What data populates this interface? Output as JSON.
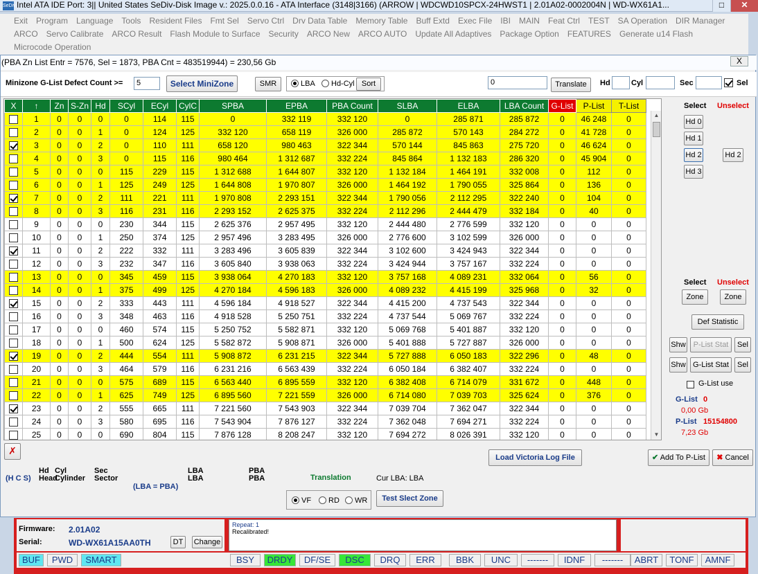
{
  "app": {
    "title": "Intel ATA IDE  Port: 3|| United States  SeDiv-Disk Image v.: 2025.0.0.16 - ATA Interface (3148|3166)  (ARROW | WDCWD10SPCX-24HWST1 | 2.01A02-0002004N | WD-WX61A1...",
    "icon_label": "SeDiv"
  },
  "menu": {
    "row1": [
      "Exit",
      "Program",
      "Language",
      "Tools",
      "Resident Files",
      "Fmt Sel",
      "Servo Ctrl",
      "Drv Data Table",
      "Memory Table",
      "Buff Extd",
      "Exec File",
      "IBI",
      "MAIN",
      "Feat Ctrl",
      "TEST",
      "SA Operation",
      "DIR Manager"
    ],
    "row2": [
      "ARCO",
      "Servo Calibrate",
      "ARCO Result",
      "Flash Module to Surface",
      "Security",
      "ARCO New",
      "ARCO AUTO",
      "Update All Adaptives",
      "Package Option",
      "FEATURES",
      "Generate u14 Flash"
    ],
    "row3": [
      "Microcode Operation"
    ]
  },
  "dialog": {
    "title": "(PBA Zn List Entr = 7576, Sel = 1873, PBA Cnt = 483519944) = 230,56 Gb",
    "close": "X"
  },
  "controls": {
    "minizone_label": "Minizone G-List Defect Count >=",
    "minizone_value": "5",
    "select_minizone": "Select MiniZone",
    "smr": "SMR",
    "lba": "LBA",
    "hdcyl": "Hd-Cyl",
    "sort": "Sort",
    "translate_value": "0",
    "translate": "Translate",
    "hd_label": "Hd",
    "cyl_label": "Cyl",
    "sec_label": "Sec",
    "sel_label": "Sel"
  },
  "table": {
    "headers": [
      "X",
      "↑",
      "Zn",
      "S-Zn",
      "Hd",
      "SCyl",
      "ECyl",
      "CylC",
      "SPBA",
      "EPBA",
      "PBA Count",
      "SLBA",
      "ELBA",
      "LBA Count",
      "G-List",
      "P-List",
      "T-List"
    ],
    "rows": [
      [
        "1",
        "0",
        "0",
        "0",
        "0",
        "114",
        "115",
        "0",
        "332 119",
        "332 120",
        "0",
        "285 871",
        "285 872",
        "0",
        "46 248",
        "0"
      ],
      [
        "2",
        "0",
        "0",
        "1",
        "0",
        "124",
        "125",
        "332 120",
        "658 119",
        "326 000",
        "285 872",
        "570 143",
        "284 272",
        "0",
        "41 728",
        "0"
      ],
      [
        "3",
        "0",
        "0",
        "2",
        "0",
        "110",
        "111",
        "658 120",
        "980 463",
        "322 344",
        "570 144",
        "845 863",
        "275 720",
        "0",
        "46 624",
        "0"
      ],
      [
        "4",
        "0",
        "0",
        "3",
        "0",
        "115",
        "116",
        "980 464",
        "1 312 687",
        "332 224",
        "845 864",
        "1 132 183",
        "286 320",
        "0",
        "45 904",
        "0"
      ],
      [
        "5",
        "0",
        "0",
        "0",
        "115",
        "229",
        "115",
        "1 312 688",
        "1 644 807",
        "332 120",
        "1 132 184",
        "1 464 191",
        "332 008",
        "0",
        "112",
        "0"
      ],
      [
        "6",
        "0",
        "0",
        "1",
        "125",
        "249",
        "125",
        "1 644 808",
        "1 970 807",
        "326 000",
        "1 464 192",
        "1 790 055",
        "325 864",
        "0",
        "136",
        "0"
      ],
      [
        "7",
        "0",
        "0",
        "2",
        "111",
        "221",
        "111",
        "1 970 808",
        "2 293 151",
        "322 344",
        "1 790 056",
        "2 112 295",
        "322 240",
        "0",
        "104",
        "0"
      ],
      [
        "8",
        "0",
        "0",
        "3",
        "116",
        "231",
        "116",
        "2 293 152",
        "2 625 375",
        "332 224",
        "2 112 296",
        "2 444 479",
        "332 184",
        "0",
        "40",
        "0"
      ],
      [
        "9",
        "0",
        "0",
        "0",
        "230",
        "344",
        "115",
        "2 625 376",
        "2 957 495",
        "332 120",
        "2 444 480",
        "2 776 599",
        "332 120",
        "0",
        "0",
        "0"
      ],
      [
        "10",
        "0",
        "0",
        "1",
        "250",
        "374",
        "125",
        "2 957 496",
        "3 283 495",
        "326 000",
        "2 776 600",
        "3 102 599",
        "326 000",
        "0",
        "0",
        "0"
      ],
      [
        "11",
        "0",
        "0",
        "2",
        "222",
        "332",
        "111",
        "3 283 496",
        "3 605 839",
        "322 344",
        "3 102 600",
        "3 424 943",
        "322 344",
        "0",
        "0",
        "0"
      ],
      [
        "12",
        "0",
        "0",
        "3",
        "232",
        "347",
        "116",
        "3 605 840",
        "3 938 063",
        "332 224",
        "3 424 944",
        "3 757 167",
        "332 224",
        "0",
        "0",
        "0"
      ],
      [
        "13",
        "0",
        "0",
        "0",
        "345",
        "459",
        "115",
        "3 938 064",
        "4 270 183",
        "332 120",
        "3 757 168",
        "4 089 231",
        "332 064",
        "0",
        "56",
        "0"
      ],
      [
        "14",
        "0",
        "0",
        "1",
        "375",
        "499",
        "125",
        "4 270 184",
        "4 596 183",
        "326 000",
        "4 089 232",
        "4 415 199",
        "325 968",
        "0",
        "32",
        "0"
      ],
      [
        "15",
        "0",
        "0",
        "2",
        "333",
        "443",
        "111",
        "4 596 184",
        "4 918 527",
        "322 344",
        "4 415 200",
        "4 737 543",
        "322 344",
        "0",
        "0",
        "0"
      ],
      [
        "16",
        "0",
        "0",
        "3",
        "348",
        "463",
        "116",
        "4 918 528",
        "5 250 751",
        "332 224",
        "4 737 544",
        "5 069 767",
        "332 224",
        "0",
        "0",
        "0"
      ],
      [
        "17",
        "0",
        "0",
        "0",
        "460",
        "574",
        "115",
        "5 250 752",
        "5 582 871",
        "332 120",
        "5 069 768",
        "5 401 887",
        "332 120",
        "0",
        "0",
        "0"
      ],
      [
        "18",
        "0",
        "0",
        "1",
        "500",
        "624",
        "125",
        "5 582 872",
        "5 908 871",
        "326 000",
        "5 401 888",
        "5 727 887",
        "326 000",
        "0",
        "0",
        "0"
      ],
      [
        "19",
        "0",
        "0",
        "2",
        "444",
        "554",
        "111",
        "5 908 872",
        "6 231 215",
        "322 344",
        "5 727 888",
        "6 050 183",
        "322 296",
        "0",
        "48",
        "0"
      ],
      [
        "20",
        "0",
        "0",
        "3",
        "464",
        "579",
        "116",
        "6 231 216",
        "6 563 439",
        "332 224",
        "6 050 184",
        "6 382 407",
        "332 224",
        "0",
        "0",
        "0"
      ],
      [
        "21",
        "0",
        "0",
        "0",
        "575",
        "689",
        "115",
        "6 563 440",
        "6 895 559",
        "332 120",
        "6 382 408",
        "6 714 079",
        "331 672",
        "0",
        "448",
        "0"
      ],
      [
        "22",
        "0",
        "0",
        "1",
        "625",
        "749",
        "125",
        "6 895 560",
        "7 221 559",
        "326 000",
        "6 714 080",
        "7 039 703",
        "325 624",
        "0",
        "376",
        "0"
      ],
      [
        "23",
        "0",
        "0",
        "2",
        "555",
        "665",
        "111",
        "7 221 560",
        "7 543 903",
        "322 344",
        "7 039 704",
        "7 362 047",
        "322 344",
        "0",
        "0",
        "0"
      ],
      [
        "24",
        "0",
        "0",
        "3",
        "580",
        "695",
        "116",
        "7 543 904",
        "7 876 127",
        "332 224",
        "7 362 048",
        "7 694 271",
        "332 224",
        "0",
        "0",
        "0"
      ],
      [
        "25",
        "0",
        "0",
        "0",
        "690",
        "804",
        "115",
        "7 876 128",
        "8 208 247",
        "332 120",
        "7 694 272",
        "8 026 391",
        "332 120",
        "0",
        "0",
        "0"
      ]
    ],
    "yellow": [
      1,
      2,
      3,
      4,
      5,
      6,
      7,
      8,
      13,
      14,
      19,
      21,
      22
    ],
    "checked": [
      3,
      7,
      11,
      15,
      19,
      23
    ]
  },
  "right": {
    "select": "Select",
    "unselect": "Unselect",
    "hd0": "Hd 0",
    "hd1": "Hd 1",
    "hd2": "Hd 2",
    "hd3": "Hd 3",
    "hd2b": "Hd 2",
    "select2": "Select",
    "unselect2": "Unselect",
    "zone": "Zone",
    "zone2": "Zone",
    "def_statistic": "Def Statistic",
    "shw1": "Shw",
    "plist_stat": "P-List Stat",
    "sel1": "Sel",
    "shw2": "Shw",
    "glist_stat": "G-List Stat",
    "sel2": "Sel",
    "glist_use": "G-List use",
    "glist_label": "G-List",
    "glist_count": "0",
    "glist_gb": "0,00 Gb",
    "plist_label": "P-List",
    "plist_count": "15154800",
    "plist_gb": "7,23 Gb"
  },
  "bottom": {
    "hd": "Hd",
    "cyl": "Cyl",
    "sec": "Sec",
    "head": "Head",
    "cylinder": "Cylinder",
    "sector": "Sector",
    "hcs": "(H C S)",
    "lba1": "LBA",
    "lba2": "LBA",
    "pba1": "PBA",
    "pba2": "PBA",
    "lba_eq_pba": "(LBA = PBA)",
    "translation": "Translation",
    "cur_lba": "Cur LBA:  LBA",
    "vf": "VF",
    "rd": "RD",
    "wr": "WR",
    "test_zone": "Test Slect Zone",
    "load_log": "Load Victoria Log File",
    "add_plist": "Add To P-List",
    "cancel": "Cancel"
  },
  "main": {
    "firmware_label": "Firmware:",
    "firmware": "2.01A02",
    "serial_label": "Serial:",
    "serial": "WD-WX61A15AA0TH",
    "dt": "DT",
    "change": "Change",
    "log1": "Repeat: 1",
    "log2": "Recalibrated!"
  },
  "status": {
    "buf": "BUF",
    "pwd": "PWD",
    "smart": "SMART",
    "bsy": "BSY",
    "drdy": "DRDY",
    "dfse": "DF/SE",
    "dsc": "DSC",
    "drq": "DRQ",
    "err": "ERR",
    "bbk": "BBK",
    "unc": "UNC",
    "d1": "-------",
    "idnf": "IDNF",
    "d2": "-------",
    "abrt": "ABRT",
    "tonf": "TONF",
    "amnf": "AMNF"
  }
}
